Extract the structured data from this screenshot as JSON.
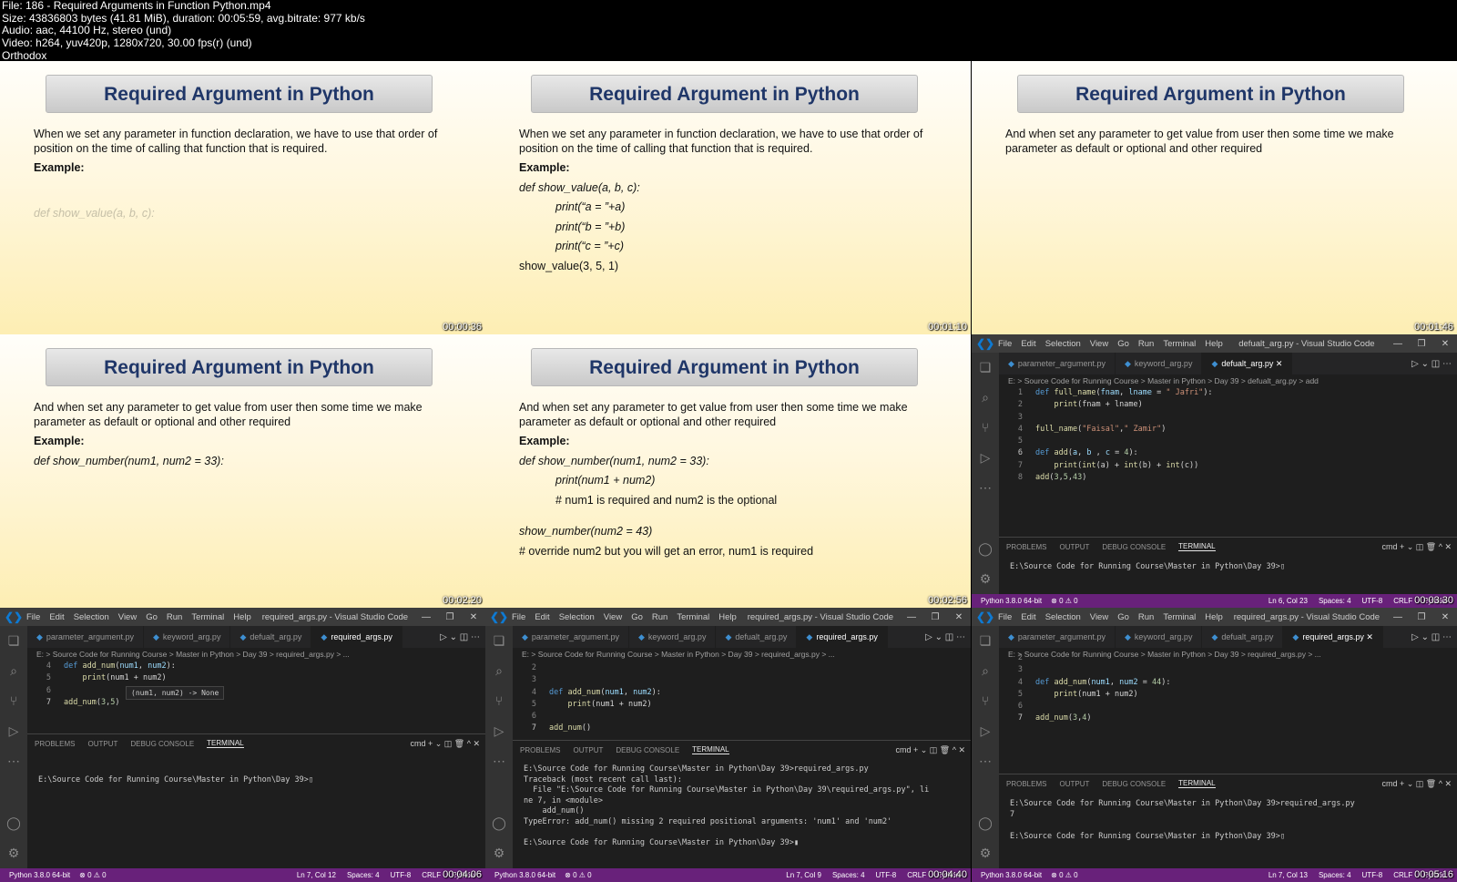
{
  "file_info": {
    "lines": [
      "File: 186 -  Required Arguments in Function Python.mp4",
      "Size: 43836803 bytes (41.81 MiB), duration: 00:05:59, avg.bitrate: 977 kb/s",
      "Audio: aac, 44100 Hz, stereo (und)",
      "Video: h264, yuv420p, 1280x720, 30.00 fps(r) (und)",
      "Orthodox"
    ]
  },
  "timestamps": [
    "00:00:36",
    "00:01:10",
    "00:01:46",
    "00:02:20",
    "00:02:56",
    "00:03:30",
    "00:04:06",
    "00:04:40",
    "00:05:16"
  ],
  "slides": {
    "title": "Required Argument in Python",
    "intro": "When we set any parameter in function declaration, we have to use that order of position on the time of calling that function that is required.",
    "intro2": "And when set any parameter to get value from user then some time we make parameter as default or optional and other required",
    "example_label": "Example:",
    "s1_def": "def show_value(a, b, c):",
    "s2": {
      "def": "def show_value(a, b, c):",
      "p1": "print(“a = ”+a)",
      "p2": "print(“b = ”+b)",
      "p3": "print(“c = ”+c)",
      "call": "show_value(3, 5, 1)"
    },
    "s4_def": "def show_number(num1, num2 = 33):",
    "s5": {
      "def": "def show_number(num1, num2 = 33):",
      "p1": "print(num1 + num2)",
      "c1": "# num1 is required and num2 is the optional",
      "call": "show_number(num2 = 43)",
      "c2": "# override num2 but you will get an error, num1 is required"
    }
  },
  "vscode": {
    "menu": [
      "File",
      "Edit",
      "Selection",
      "View",
      "Go",
      "Run",
      "Terminal",
      "Help"
    ],
    "title_default": "defualt_arg.py - Visual Studio Code",
    "title_required": "required_args.py - Visual Studio Code",
    "tabs": [
      "parameter_argument.py",
      "keyword_arg.py",
      "defualt_arg.py",
      "required_args.py"
    ],
    "bc_default": "E: > Source Code for Running Course > Master in Python > Day 39 > defualt_arg.py > add",
    "bc_required": "E: > Source Code for Running Course > Master in Python > Day 39 > required_args.py > ...",
    "panel_tabs": [
      "PROBLEMS",
      "OUTPUT",
      "DEBUG CONSOLE",
      "TERMINAL"
    ],
    "panel_ctl": "cmd  +  ⌄  ◫  🗑  ^  ✕",
    "prompt": "E:\\Source Code for Running Course\\Master in Python\\Day 39>",
    "prompt_run": "E:\\Source Code for Running Course\\Master in Python\\Day 39>required_args.py",
    "traceback": [
      "Traceback (most recent call last):",
      "  File \"E:\\Source Code for Running Course\\Master in Python\\Day 39\\required_args.py\", li",
      "ne 7, in <module>",
      "    add_num()",
      "TypeError: add_num() missing 2 required positional arguments: 'num1' and 'num2'"
    ],
    "output_7": "7",
    "hint": "(num1, num2) -> None",
    "status_left": "Python 3.8.0 64-bit",
    "status_err": "⊗ 0 ⚠ 0",
    "status_6": [
      "Ln 6, Col 23",
      "Spaces: 4",
      "UTF-8",
      "CRLF",
      "Python"
    ],
    "status_7": [
      "Ln 7, Col 12",
      "Spaces: 4",
      "UTF-8",
      "CRLF",
      "Python"
    ],
    "status_8": [
      "Ln 7, Col 9",
      "Spaces: 4",
      "UTF-8",
      "CRLF",
      "Python"
    ],
    "status_9": [
      "Ln 7, Col 13",
      "Spaces: 4",
      "UTF-8",
      "CRLF",
      "Python"
    ]
  }
}
